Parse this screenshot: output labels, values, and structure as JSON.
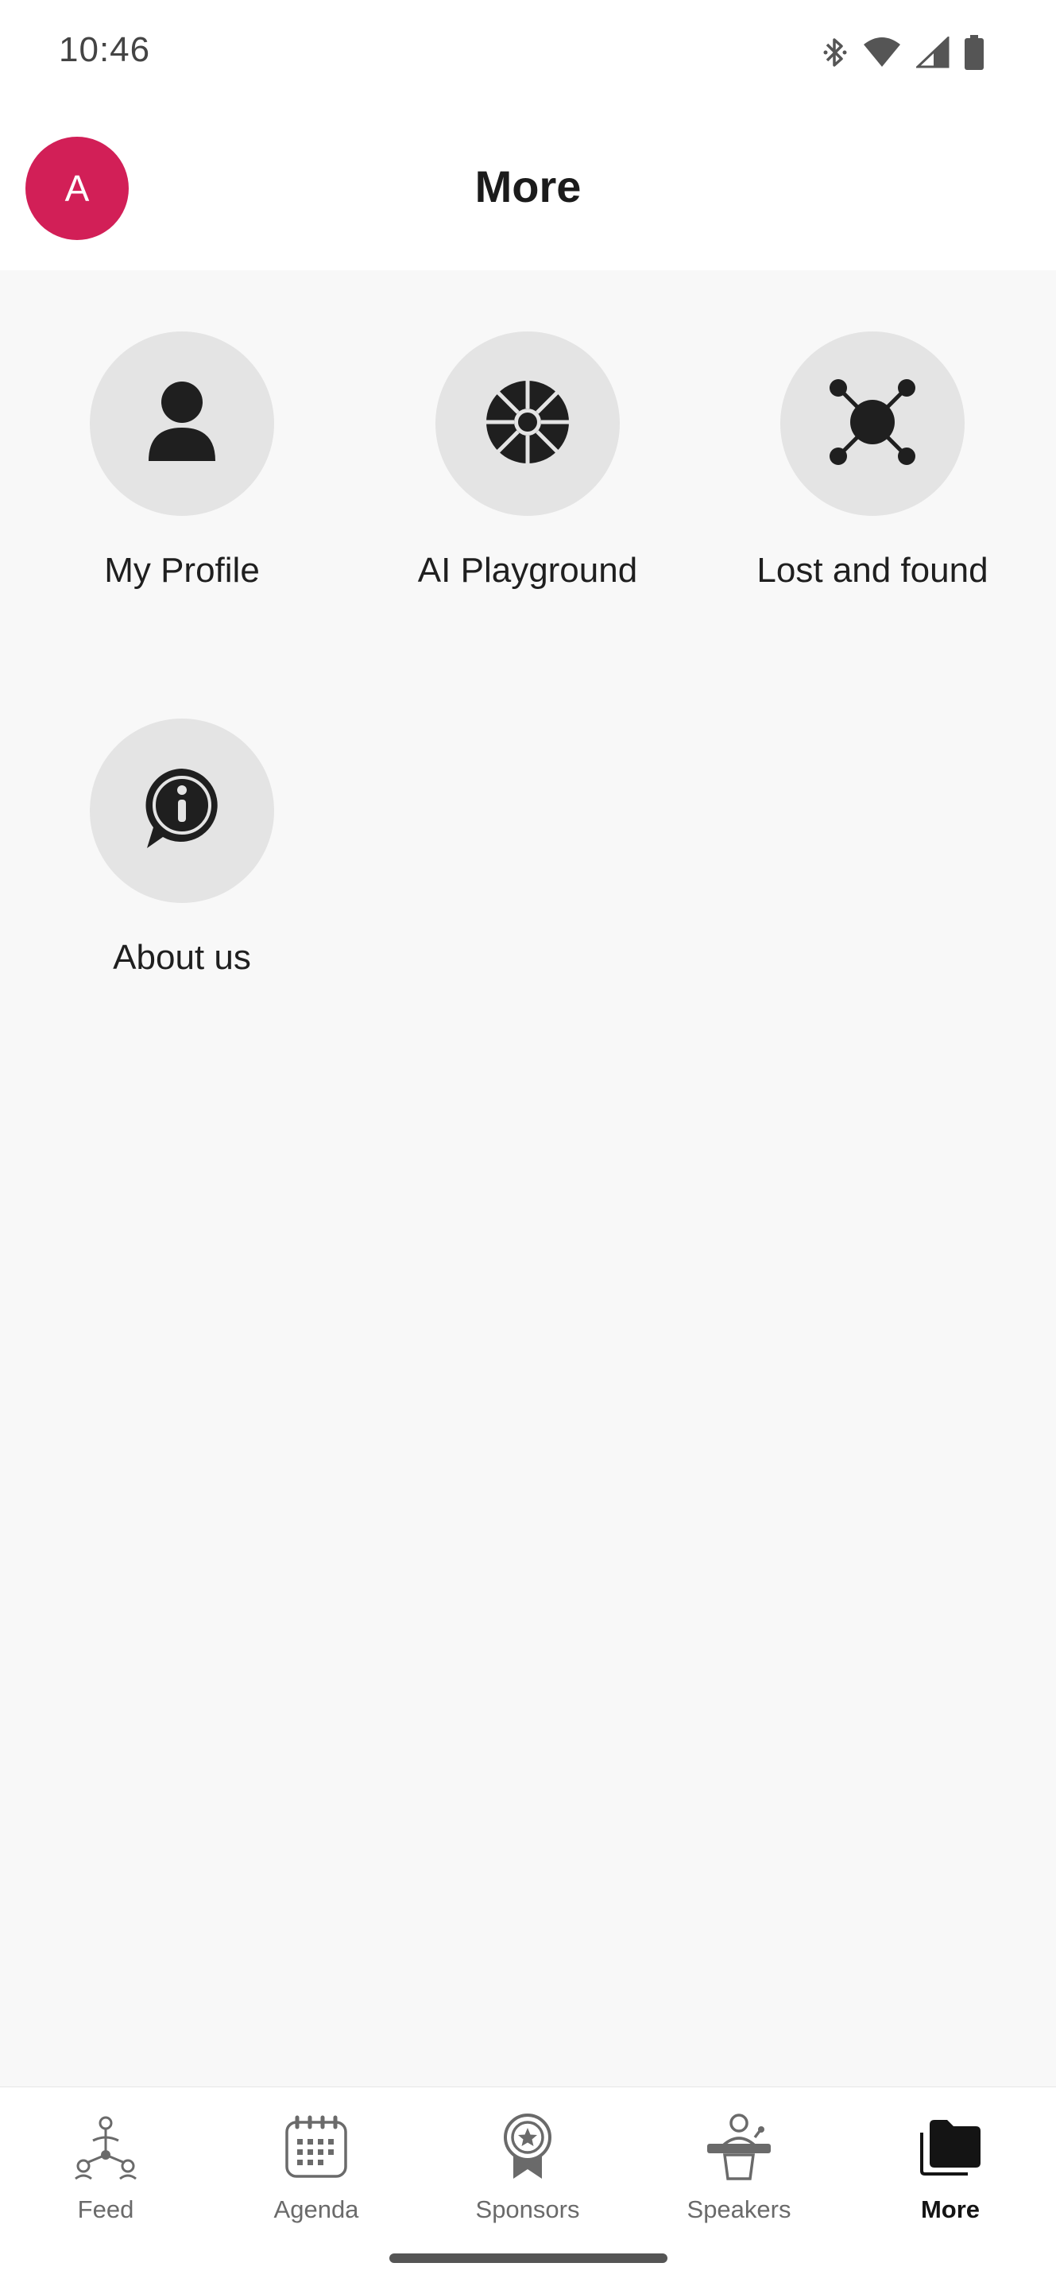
{
  "status_bar": {
    "time": "10:46",
    "icons": [
      "bluetooth-icon",
      "wifi-icon",
      "signal-icon",
      "battery-icon"
    ]
  },
  "header": {
    "avatar_letter": "A",
    "avatar_color": "#d21f57",
    "title": "More"
  },
  "tiles": [
    {
      "label": "My Profile",
      "icon": "person-icon"
    },
    {
      "label": "AI Playground",
      "icon": "wheel-icon"
    },
    {
      "label": "Lost and found",
      "icon": "hub-icon"
    },
    {
      "label": "About us",
      "icon": "info-bubble-icon"
    }
  ],
  "bottom_nav": {
    "items": [
      {
        "label": "Feed",
        "icon": "feed-network-icon"
      },
      {
        "label": "Agenda",
        "icon": "calendar-icon"
      },
      {
        "label": "Sponsors",
        "icon": "award-icon"
      },
      {
        "label": "Speakers",
        "icon": "speaker-podium-icon"
      },
      {
        "label": "More",
        "icon": "folder-icon"
      }
    ],
    "active": "More"
  }
}
